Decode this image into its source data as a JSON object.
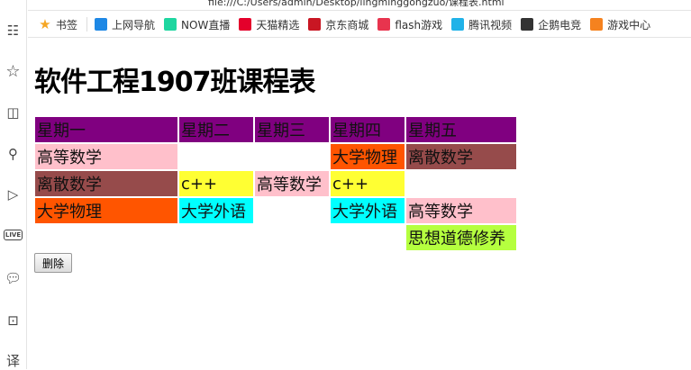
{
  "browser": {
    "address": "file:///C:/Users/admin/Desktop/lingminggongzuo/课程表.html",
    "bookmarks": [
      {
        "label": "书签",
        "icon": "star-icon",
        "color": "#f5a623"
      },
      {
        "label": "上网导航",
        "icon": "ie-icon",
        "color": "#1e88e5"
      },
      {
        "label": "NOW直播",
        "icon": "now-icon",
        "color": "#1ed6a0"
      },
      {
        "label": "天猫精选",
        "icon": "tmall-icon",
        "color": "#e4002b"
      },
      {
        "label": "京东商城",
        "icon": "jd-icon",
        "color": "#c91623"
      },
      {
        "label": "flash游戏",
        "icon": "flash-icon",
        "color": "#e8344e"
      },
      {
        "label": "腾讯视频",
        "icon": "play-icon",
        "color": "#20b2e8"
      },
      {
        "label": "企鹅电竞",
        "icon": "penguin-icon",
        "color": "#333333"
      },
      {
        "label": "游戏中心",
        "icon": "gamepad-icon",
        "color": "#f5821f"
      }
    ],
    "sidebar_icons": [
      "news-icon",
      "star-icon",
      "book-icon",
      "search-icon",
      "video-icon",
      "live-icon",
      "chat-icon",
      "briefcase-icon",
      "translate-icon"
    ],
    "live_label": "LIVE",
    "translate_label": "译"
  },
  "page": {
    "title": "软件工程1907班课程表",
    "delete_label": "删除",
    "headers": [
      {
        "text": "星期一",
        "bg": "#800080"
      },
      {
        "text": "星期二",
        "bg": "#800080"
      },
      {
        "text": "星期三",
        "bg": "#800080"
      },
      {
        "text": "星期四",
        "bg": "#800080"
      },
      {
        "text": "星期五",
        "bg": "#800080"
      }
    ],
    "rows": [
      [
        {
          "text": "高等数学",
          "bg": "#ffc0cb"
        },
        {
          "text": "",
          "bg": ""
        },
        {
          "text": "",
          "bg": ""
        },
        {
          "text": "大学物理",
          "bg": "#ff5500"
        },
        {
          "text": "离散数学",
          "bg": "#964b4b"
        }
      ],
      [
        {
          "text": "离散数学",
          "bg": "#964b4b"
        },
        {
          "text": "c++",
          "bg": "#ffff33"
        },
        {
          "text": "高等数学",
          "bg": "#ffc0cb"
        },
        {
          "text": "c++",
          "bg": "#ffff33"
        },
        {
          "text": "",
          "bg": ""
        }
      ],
      [
        {
          "text": "大学物理",
          "bg": "#ff5500"
        },
        {
          "text": "大学外语",
          "bg": "#00ffff"
        },
        {
          "text": "",
          "bg": ""
        },
        {
          "text": "大学外语",
          "bg": "#00ffff"
        },
        {
          "text": "高等数学",
          "bg": "#ffc0cb"
        }
      ],
      [
        {
          "text": "",
          "bg": ""
        },
        {
          "text": "",
          "bg": ""
        },
        {
          "text": "",
          "bg": ""
        },
        {
          "text": "",
          "bg": ""
        },
        {
          "text": "思想道德修养",
          "bg": "#b5ff3f"
        }
      ]
    ]
  }
}
